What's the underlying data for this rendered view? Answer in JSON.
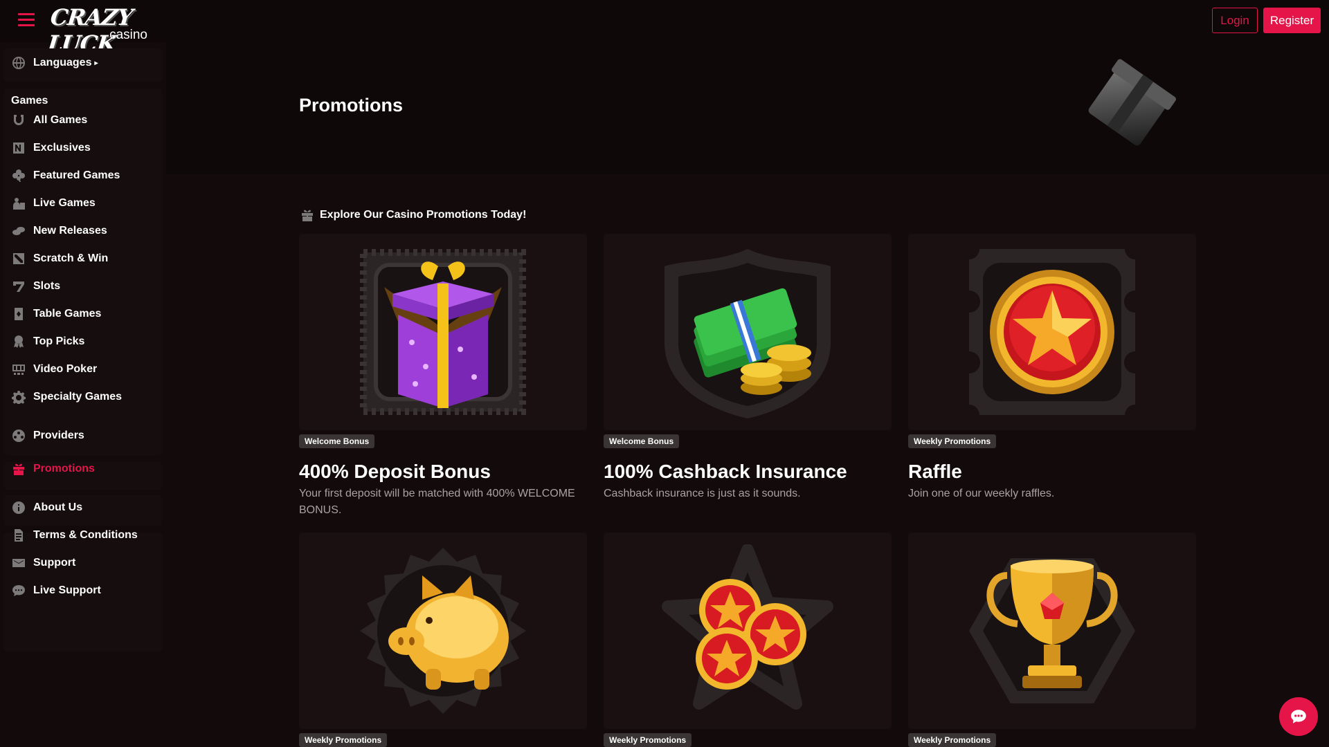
{
  "header": {
    "logo_main": "CRAZY LUCK",
    "logo_sub": "casino",
    "login_label": "Login",
    "register_label": "Register"
  },
  "sidebar": {
    "languages_label": "Languages",
    "games_heading": "Games",
    "games": [
      {
        "label": "All Games",
        "icon": "horseshoe-icon"
      },
      {
        "label": "Exclusives",
        "icon": "exclusive-icon"
      },
      {
        "label": "Featured Games",
        "icon": "clover-icon"
      },
      {
        "label": "Live Games",
        "icon": "live-dealer-icon"
      },
      {
        "label": "New Releases",
        "icon": "chips-icon"
      },
      {
        "label": "Scratch & Win",
        "icon": "scratch-card-icon"
      },
      {
        "label": "Slots",
        "icon": "seven-icon"
      },
      {
        "label": "Table Games",
        "icon": "card-icon"
      },
      {
        "label": "Top Picks",
        "icon": "award-icon"
      },
      {
        "label": "Video Poker",
        "icon": "video-poker-icon"
      },
      {
        "label": "Specialty Games",
        "icon": "gear-icon"
      }
    ],
    "providers_label": "Providers",
    "promotions_label": "Promotions",
    "info": [
      {
        "label": "About Us",
        "icon": "info-icon"
      },
      {
        "label": "Terms & Conditions",
        "icon": "document-icon"
      },
      {
        "label": "Support",
        "icon": "mail-icon"
      },
      {
        "label": "Live Support",
        "icon": "chat-bubble-icon"
      }
    ]
  },
  "main": {
    "page_title": "Promotions",
    "section_title": "Explore Our Casino Promotions Today!",
    "cards": [
      {
        "badge": "Welcome Bonus",
        "title": "400% Deposit Bonus",
        "description": "Your first deposit will be matched with 400% WELCOME BONUS.",
        "icon": "gift-box-icon"
      },
      {
        "badge": "Welcome Bonus",
        "title": "100% Cashback Insurance",
        "description": "Cashback insurance is just as it sounds.",
        "icon": "cash-coins-icon"
      },
      {
        "badge": "Weekly Promotions",
        "title": "Raffle",
        "description": "Join one of our weekly raffles.",
        "icon": "star-medal-icon"
      },
      {
        "badge": "Weekly Promotions",
        "title": "",
        "description": "",
        "icon": "piggy-bank-icon"
      },
      {
        "badge": "Weekly Promotions",
        "title": "",
        "description": "",
        "icon": "star-coins-icon"
      },
      {
        "badge": "Weekly Promotions",
        "title": "",
        "description": "",
        "icon": "trophy-icon"
      }
    ]
  },
  "colors": {
    "accent": "#e5154a",
    "background": "#120a0b",
    "sidebar": "#160d0e",
    "muted_text": "#a8a3a4"
  }
}
